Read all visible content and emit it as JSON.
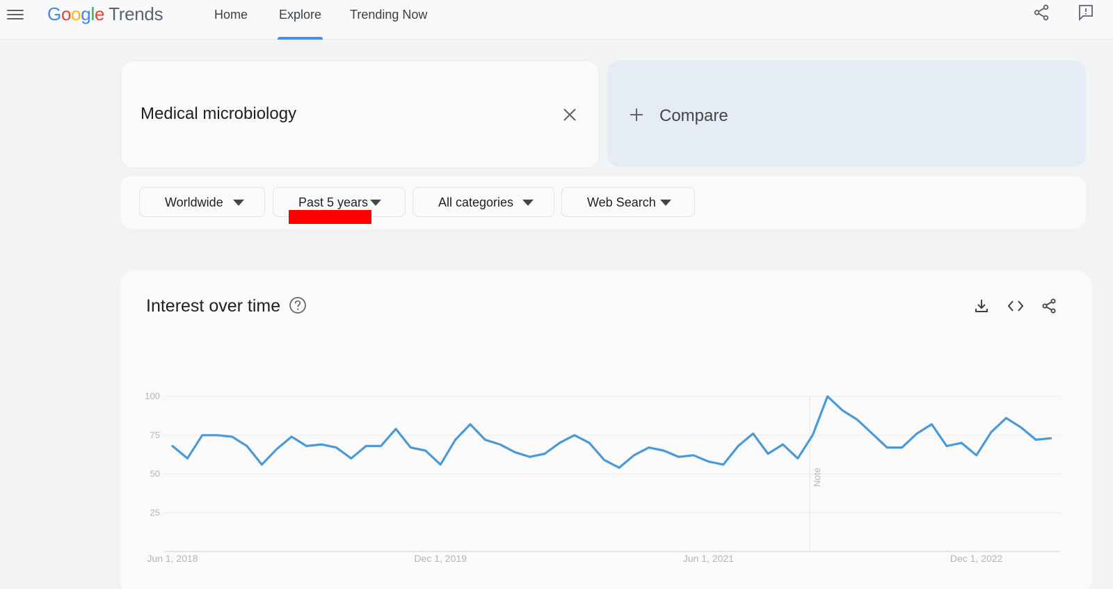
{
  "header": {
    "logo": {
      "google": [
        "G",
        "o",
        "o",
        "g",
        "l",
        "e"
      ],
      "product": "Trends"
    },
    "tabs": [
      {
        "label": "Home",
        "active": false
      },
      {
        "label": "Explore",
        "active": true
      },
      {
        "label": "Trending Now",
        "active": false
      }
    ],
    "icons": [
      "menu-icon",
      "share-icon",
      "feedback-icon"
    ],
    "active_tab_color": "#4a8fe7"
  },
  "search": {
    "term": "Medical microbiology",
    "compare_label": "Compare"
  },
  "filters": {
    "location": "Worldwide",
    "time_range": "Past 5 years",
    "category": "All categories",
    "search_type": "Web Search",
    "highlight_color": "#ff0000"
  },
  "interest_card": {
    "title": "Interest over time",
    "icons": [
      "help-icon",
      "download-icon",
      "embed-icon",
      "share-icon"
    ]
  },
  "chart_data": {
    "type": "line",
    "title": "",
    "xlabel": "",
    "ylabel": "",
    "ylim": [
      0,
      100
    ],
    "y_ticks": [
      "25",
      "50",
      "75",
      "100"
    ],
    "x_tick_labels": [
      "Jun 1, 2018",
      "Dec 1, 2019",
      "Jun 1, 2021",
      "Dec 1, 2022"
    ],
    "x_tick_positions": [
      0,
      18,
      36,
      54
    ],
    "note_label": "Note",
    "note_index": 43,
    "grid": true,
    "line_color": "#4a9ad9",
    "series": [
      {
        "values": [
          68,
          60,
          75,
          75,
          74,
          68,
          56,
          66,
          74,
          68,
          69,
          67,
          60,
          68,
          68,
          79,
          67,
          65,
          56,
          72,
          82,
          72,
          69,
          64,
          61,
          63,
          70,
          75,
          70,
          59,
          54,
          62,
          67,
          65,
          61,
          62,
          58,
          56,
          68,
          76,
          63,
          69,
          60,
          75,
          100,
          91,
          85,
          76,
          67,
          67,
          76,
          82,
          68,
          70,
          62,
          77,
          86,
          80,
          72,
          73
        ]
      }
    ]
  }
}
